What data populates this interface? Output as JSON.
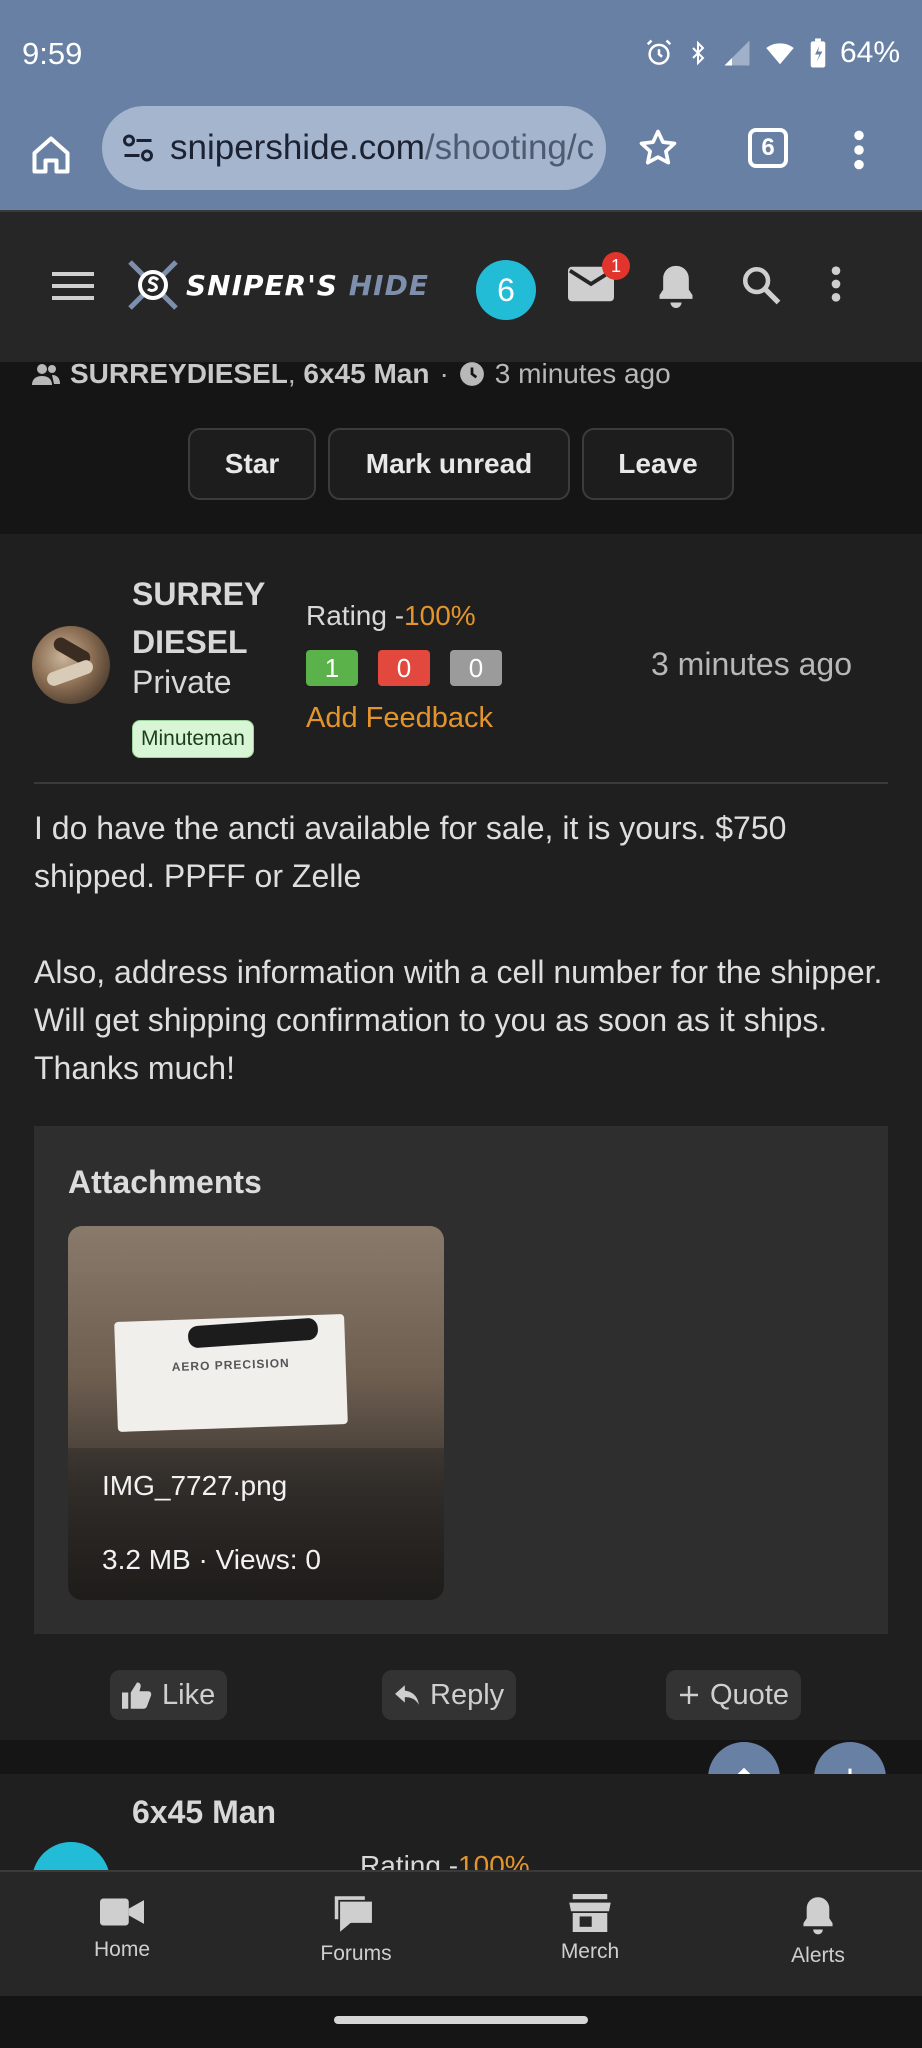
{
  "status_bar": {
    "time": "9:59",
    "battery": "64%"
  },
  "browser": {
    "url_host": "snipershide.com",
    "url_path": "/shooting/c",
    "tab_count": "6"
  },
  "site_header": {
    "logo_main": "SNIPER'S",
    "logo_hide": "HIDE",
    "user_initial": "6",
    "mail_count": "1"
  },
  "thread": {
    "participants": "SURREYDIESEL",
    "participants_sep": ",",
    "participant_2": "6x45 Man",
    "dot": "·",
    "time": "3 minutes ago",
    "buttons": {
      "star": "Star",
      "mark_unread": "Mark unread",
      "leave": "Leave"
    }
  },
  "post": {
    "username": "SURREY DIESEL",
    "rank": "Private",
    "badge": "Minuteman",
    "rating_label": "Rating -",
    "rating_value": "100%",
    "rating_counts": {
      "positive": "1",
      "negative": "0",
      "neutral": "0"
    },
    "add_feedback": "Add Feedback",
    "time": "3 minutes ago",
    "body": [
      "I do have the ancti available for sale, it is yours. $750 shipped. PPFF or Zelle",
      "Also, address information with a cell number for the shipper. Will get shipping confirmation to you as soon as it ships. Thanks much!"
    ],
    "attachments": {
      "title": "Attachments",
      "file": {
        "name": "IMG_7727.png",
        "meta": "3.2 MB · Views: 0",
        "box_text": "AERO PRECISION"
      }
    },
    "actions": {
      "like": "Like",
      "reply": "Reply",
      "quote": "Quote"
    }
  },
  "next_post": {
    "username": "6x45 Man",
    "rating_label": "Rating -",
    "rating_value": "100%"
  },
  "bottom_nav": {
    "home": "Home",
    "forums": "Forums",
    "merch": "Merch",
    "alerts": "Alerts"
  },
  "colors": {
    "chrome": "#6880a4",
    "accent_orange": "#e3952b",
    "positive": "#5cb24a",
    "negative": "#e2483d",
    "neutral": "#9b9b9b",
    "avatar_cyan": "#23bcd6"
  }
}
